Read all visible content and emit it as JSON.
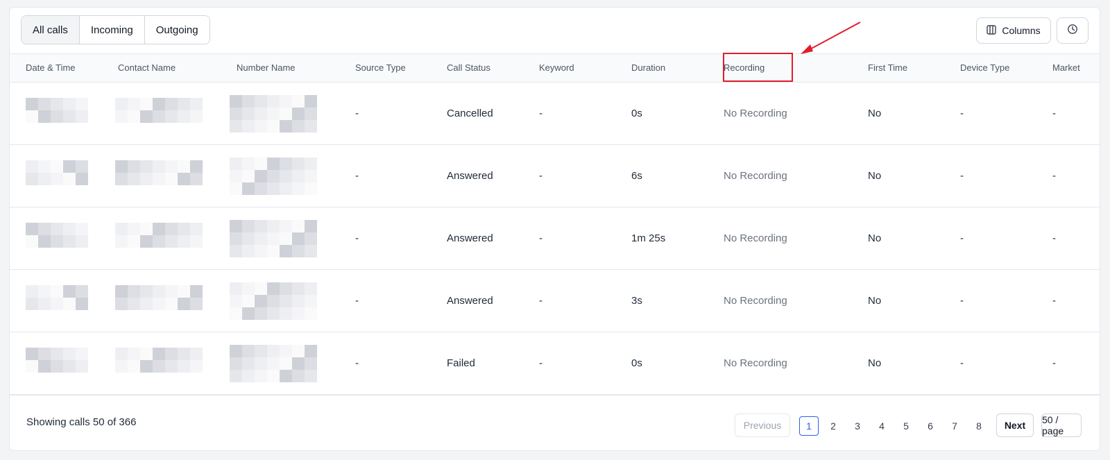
{
  "filters": {
    "tabs": [
      {
        "label": "All calls",
        "active": true
      },
      {
        "label": "Incoming",
        "active": false
      },
      {
        "label": "Outgoing",
        "active": false
      }
    ],
    "columns_button": "Columns",
    "columns_icon": "columns-icon",
    "refresh_icon": "refresh-clock-icon"
  },
  "table": {
    "headers": [
      "Date & Time",
      "Contact Name",
      "Number Name",
      "Source Type",
      "Call Status",
      "Keyword",
      "Duration",
      "Recording",
      "First Time",
      "Device Type",
      "Market"
    ],
    "rows": [
      {
        "source_type": "-",
        "call_status": "Cancelled",
        "keyword": "-",
        "duration": "0s",
        "recording": "No Recording",
        "first_time": "No",
        "device_type": "-",
        "market": "-"
      },
      {
        "source_type": "-",
        "call_status": "Answered",
        "keyword": "-",
        "duration": "6s",
        "recording": "No Recording",
        "first_time": "No",
        "device_type": "-",
        "market": "-"
      },
      {
        "source_type": "-",
        "call_status": "Answered",
        "keyword": "-",
        "duration": "1m 25s",
        "recording": "No Recording",
        "first_time": "No",
        "device_type": "-",
        "market": "-"
      },
      {
        "source_type": "-",
        "call_status": "Answered",
        "keyword": "-",
        "duration": "3s",
        "recording": "No Recording",
        "first_time": "No",
        "device_type": "-",
        "market": "-"
      },
      {
        "source_type": "-",
        "call_status": "Failed",
        "keyword": "-",
        "duration": "0s",
        "recording": "No Recording",
        "first_time": "No",
        "device_type": "-",
        "market": "-"
      }
    ]
  },
  "annotation": {
    "highlight_color": "#e11d2a"
  },
  "pagination": {
    "showing": "Showing calls 50 of 366",
    "previous": "Previous",
    "next": "Next",
    "pages": [
      "1",
      "2",
      "3",
      "4",
      "5",
      "6",
      "7",
      "8"
    ],
    "current_page": "1",
    "per_page": "50 / page"
  }
}
